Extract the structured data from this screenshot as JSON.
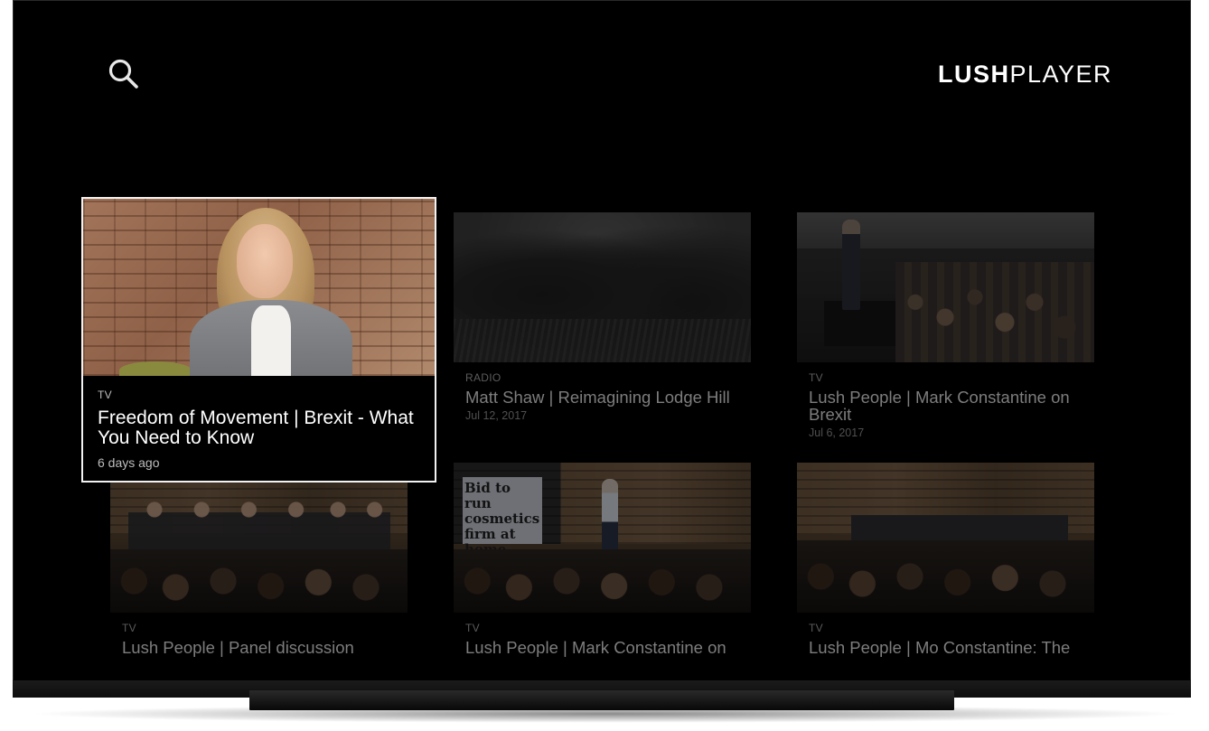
{
  "app": {
    "logo_bold": "LUSH",
    "logo_light": "PLAYER",
    "search_icon": "search-icon"
  },
  "cards": [
    {
      "category": "TV",
      "title": "Freedom of Movement | Brexit - What You Need to Know",
      "date": "6 days ago",
      "focused": true
    },
    {
      "category": "RADIO",
      "title": "Matt Shaw | Reimagining Lodge Hill",
      "date": "Jul 12, 2017"
    },
    {
      "category": "TV",
      "title": "Lush People | Mark Constantine on Brexit",
      "date": "Jul 6, 2017"
    },
    {
      "category": "TV",
      "title": "Lush People | Panel discussion",
      "date": ""
    },
    {
      "category": "TV",
      "title": "Lush People | Mark Constantine on",
      "date": "",
      "sign_text": "Bid to run cosmetics firm at home"
    },
    {
      "category": "TV",
      "title": "Lush People | Mo Constantine: The",
      "date": ""
    }
  ],
  "colors": {
    "background": "#000000",
    "focus_border": "#f2f2f2",
    "text_primary": "#ffffff",
    "text_dim": "#7d7d7d"
  }
}
